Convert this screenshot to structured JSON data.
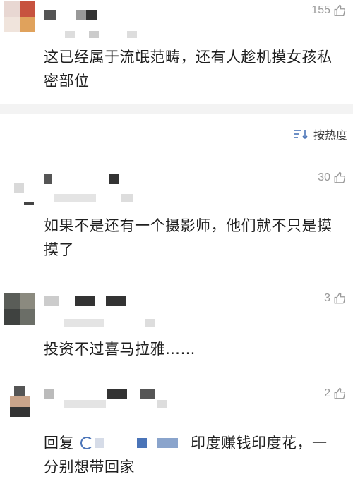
{
  "comments": [
    {
      "likes": "155",
      "text": "这已经属于流氓范畴，还有人趁机摸女孩私密部位"
    },
    {
      "likes": "30",
      "text": "如果不是还有一个摄影师，他们就不只是摸摸了"
    },
    {
      "likes": "3",
      "text": "投资不过喜马拉雅……"
    },
    {
      "likes": "2",
      "reply_label": "回复",
      "text_after": "印度赚钱印度花，一",
      "text_line2": "分别想带回家"
    }
  ],
  "sort": {
    "label": "按热度",
    "icon": "sort-icon"
  },
  "colors": {
    "background": "#ffffff",
    "divider": "#f3f3f3",
    "text": "#1f1f1f",
    "muted": "#999999",
    "link_blue": "#4a74b8"
  }
}
